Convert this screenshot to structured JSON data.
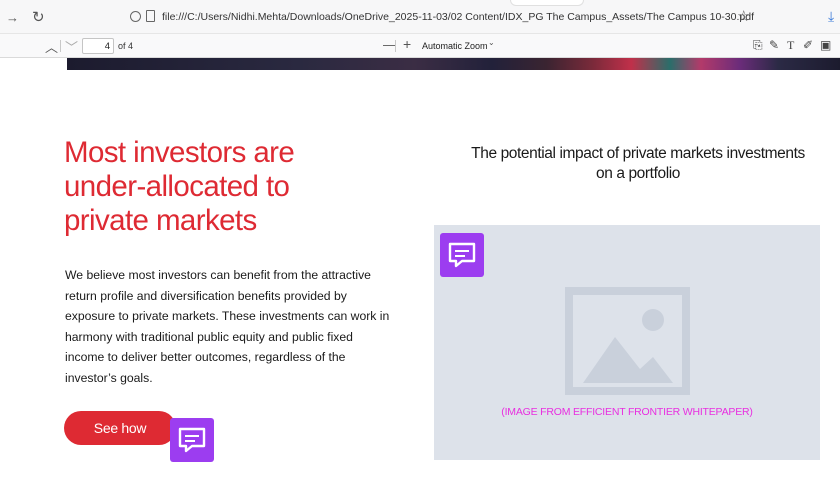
{
  "browser": {
    "url": "file:///C:/Users/Nidhi.Mehta/Downloads/OneDrive_2025-11-03/02 Content/IDX_PG The Campus_Assets/The Campus 10-30.pdf",
    "icons": [
      "forward-icon",
      "reload-icon",
      "shield-icon",
      "page-icon",
      "bookmark-star-icon",
      "download-icon"
    ]
  },
  "pdf_toolbar": {
    "page_number": "4",
    "page_total": "of 4",
    "zoom_minus": "—",
    "zoom_plus": "+",
    "zoom_level": "Automatic Zoom",
    "tools": [
      "text-highlight-icon",
      "draw-icon",
      "text-icon",
      "ink-icon",
      "image-icon"
    ]
  },
  "page": {
    "headline": "Most investors are under-allocated to private markets",
    "body": "We believe most investors can benefit from the attractive return profile and diversification benefits provided by exposure to private markets. These investments can work in harmony with traditional public equity and public fixed income to deliver better outcomes, regardless of the investor’s goals.",
    "cta_label": "See how",
    "chart_title": "The potential impact of private markets investments on a portfolio",
    "image_caption": "(IMAGE FROM EFFICIENT FRONTIER WHITEPAPER)"
  },
  "colors": {
    "accent_red": "#de2a33",
    "comment_purple": "#9c3df0",
    "caption_magenta": "#e82fe0",
    "placeholder_bg": "#dde2ea"
  }
}
